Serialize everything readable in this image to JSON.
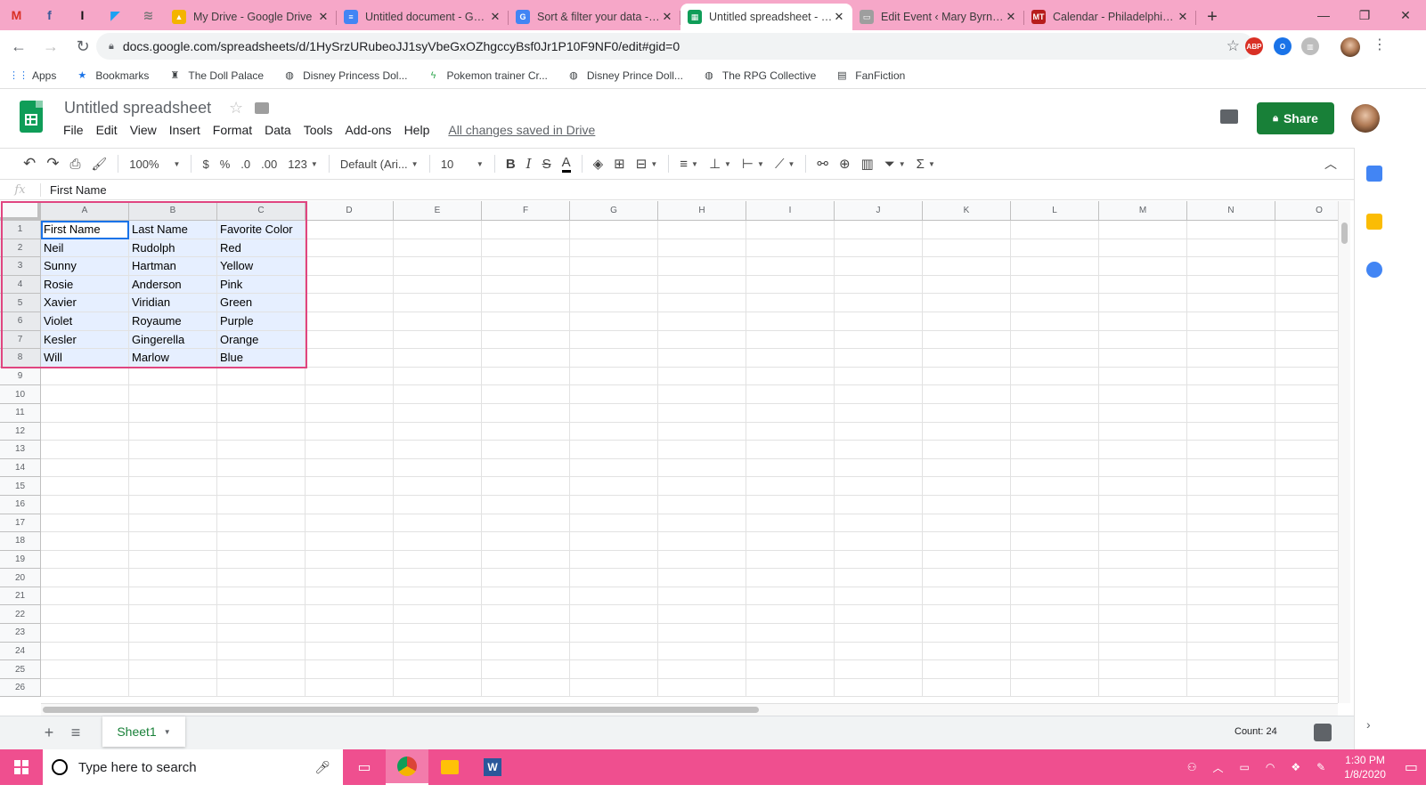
{
  "browser": {
    "pinned_tabs": [
      {
        "icon": "gmail-icon",
        "glyph": "M",
        "color": "#d93025"
      },
      {
        "icon": "facebook-icon",
        "glyph": "f",
        "color": "#3b5998"
      },
      {
        "icon": "instapaper-icon",
        "glyph": "I",
        "color": "#111111"
      },
      {
        "icon": "tweetdeck-icon",
        "glyph": "◤",
        "color": "#1da1f2"
      },
      {
        "icon": "reader-icon",
        "glyph": "≋",
        "color": "#777777"
      }
    ],
    "tabs": [
      {
        "title": "My Drive - Google Drive",
        "favicon": "▲",
        "favicon_color": "#f4b400",
        "active": false
      },
      {
        "title": "Untitled document - Google Docs",
        "favicon": "≡",
        "favicon_color": "#4285f4",
        "active": false
      },
      {
        "title": "Sort & filter your data - Computer",
        "favicon": "G",
        "favicon_color": "#4285f4",
        "active": false
      },
      {
        "title": "Untitled spreadsheet - Google Sheets",
        "favicon": "▦",
        "favicon_color": "#0f9d58",
        "active": true
      },
      {
        "title": "Edit Event ‹ Mary Byrnes — WordPress",
        "favicon": "▭",
        "favicon_color": "#9e9e9e",
        "active": false
      },
      {
        "title": "Calendar - Philadelphia Magazine",
        "favicon": "MT",
        "favicon_color": "#b71c1c",
        "active": false
      }
    ],
    "new_tab": "+",
    "window_controls": [
      "—",
      "❐",
      "✕"
    ],
    "url": "docs.google.com/spreadsheets/d/1HySrzURubeoJJ1syVbeGxOZhgccyBsf0Jr1P10F9NF0/edit#gid=0",
    "extensions": [
      {
        "label": "ABP",
        "color": "#d93025"
      },
      {
        "label": "O",
        "color": "#1a73e8"
      },
      {
        "label": "▥",
        "color": "#bdbdbd"
      }
    ],
    "bookmarks": [
      {
        "label": "Apps",
        "icon": "apps-grid-icon",
        "glyph": "⋮⋮"
      },
      {
        "label": "Bookmarks",
        "icon": "star-icon",
        "glyph": "★"
      },
      {
        "label": "The Doll Palace",
        "icon": "doll-palace-icon",
        "glyph": "♜"
      },
      {
        "label": "Disney Princess Dol...",
        "icon": "globe-icon",
        "glyph": "◍"
      },
      {
        "label": "Pokemon trainer Cr...",
        "icon": "pokemon-icon",
        "glyph": "ϟ"
      },
      {
        "label": "Disney Prince Doll...",
        "icon": "globe-icon",
        "glyph": "◍"
      },
      {
        "label": "The RPG Collective",
        "icon": "globe-icon",
        "glyph": "◍"
      },
      {
        "label": "FanFiction",
        "icon": "fanfiction-icon",
        "glyph": "▤"
      }
    ]
  },
  "sheets": {
    "title": "Untitled spreadsheet",
    "menu": [
      "File",
      "Edit",
      "View",
      "Insert",
      "Format",
      "Data",
      "Tools",
      "Add-ons",
      "Help"
    ],
    "saved_status": "All changes saved in Drive",
    "share_label": "Share",
    "toolbar": {
      "zoom": "100%",
      "currency": "$",
      "percent": "%",
      "decimal_decrease": ".0",
      "decimal_increase": ".00",
      "more_formats": "123",
      "font": "Default (Ari...",
      "font_size": "10",
      "bold": "B",
      "italic": "I",
      "strikethrough": "S",
      "text_color": "A",
      "sum": "Σ"
    },
    "formula_bar": {
      "fx": "fx",
      "value": "First Name"
    },
    "columns": [
      "A",
      "B",
      "C",
      "D",
      "E",
      "F",
      "G",
      "H",
      "I",
      "J",
      "K",
      "L",
      "M",
      "N",
      "O"
    ],
    "rows": [
      "1",
      "2",
      "3",
      "4",
      "5",
      "6",
      "7",
      "8",
      "9",
      "10",
      "11",
      "12",
      "13",
      "14",
      "15",
      "16",
      "17",
      "18",
      "19",
      "20",
      "21",
      "22",
      "23",
      "24",
      "25",
      "26"
    ],
    "data": [
      [
        "First Name",
        "Last Name",
        "Favorite Color"
      ],
      [
        "Neil",
        "Rudolph",
        "Red"
      ],
      [
        "Sunny",
        "Hartman",
        "Yellow"
      ],
      [
        "Rosie",
        "Anderson",
        "Pink"
      ],
      [
        "Xavier",
        "Viridian",
        "Green"
      ],
      [
        "Violet",
        "Royaume",
        "Purple"
      ],
      [
        "Kesler",
        "Gingerella",
        "Orange"
      ],
      [
        "Will",
        "Marlow",
        "Blue"
      ]
    ],
    "sheet_tab": "Sheet1",
    "count": "Count: 24",
    "selection_color": "#e04580"
  },
  "taskbar": {
    "search_placeholder": "Type here to search",
    "time": "1:30 PM",
    "date": "1/8/2020",
    "accent": "#ef4f8f"
  }
}
